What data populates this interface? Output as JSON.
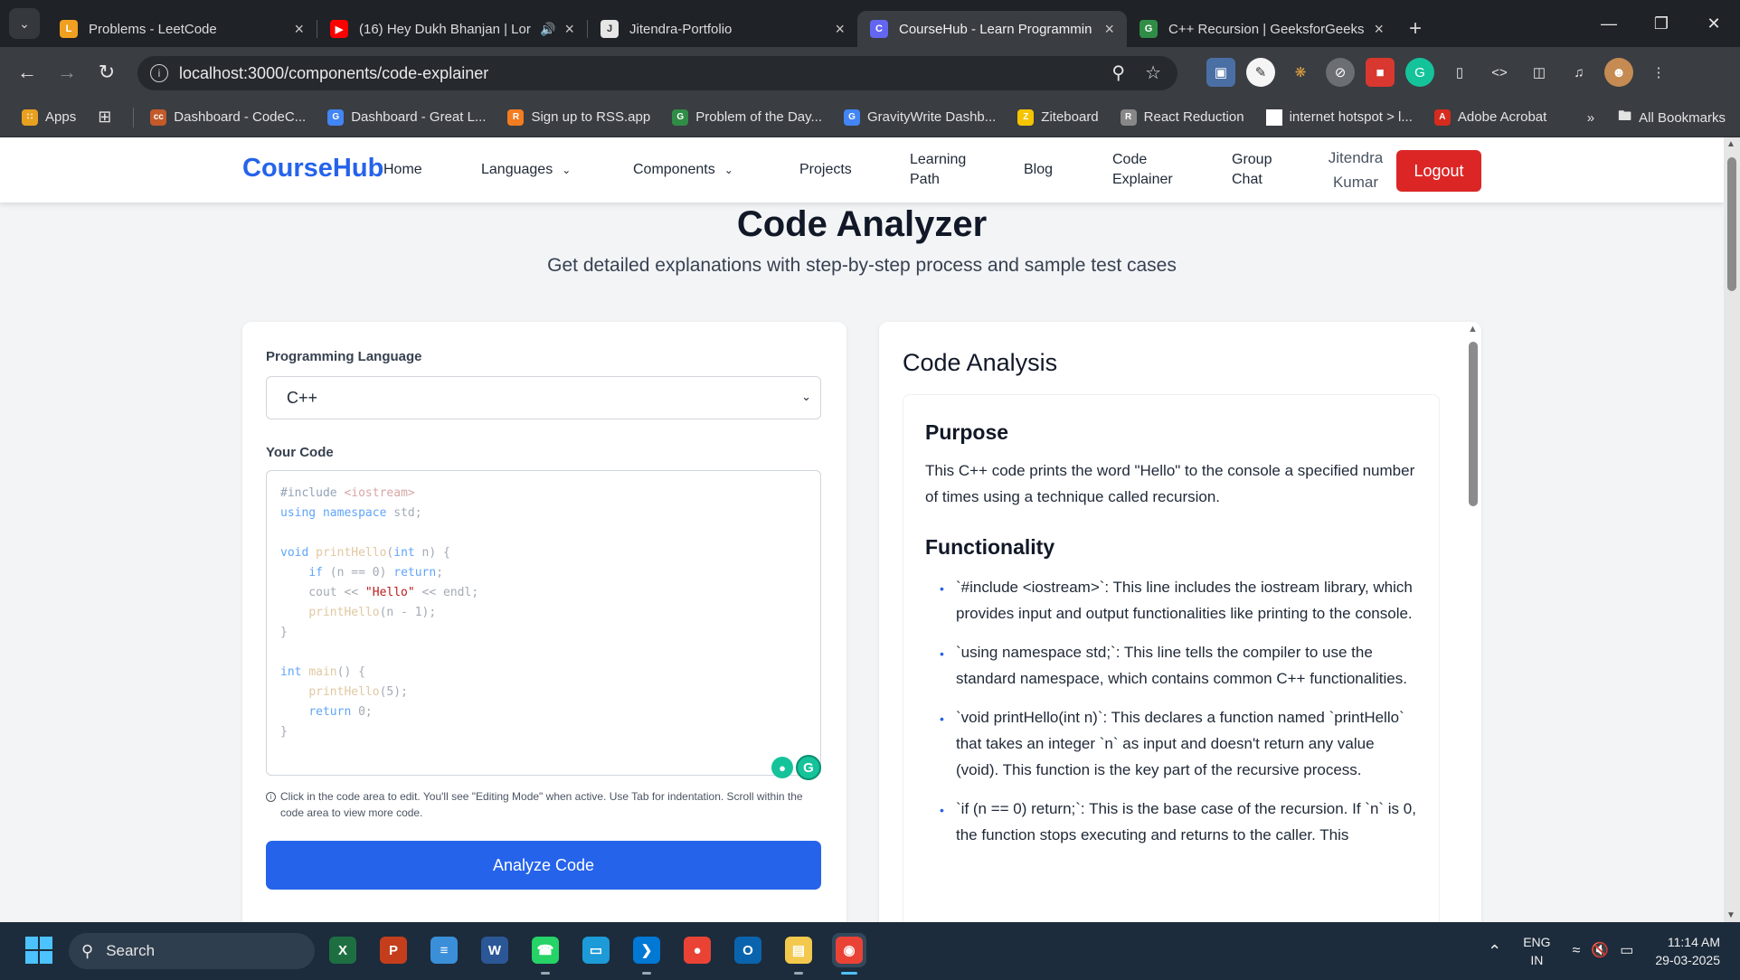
{
  "browser": {
    "tabs": [
      {
        "title": "Problems - LeetCode",
        "favicon_color": "#f0a020",
        "favicon_glyph": "L",
        "active": false,
        "playing": false
      },
      {
        "title": "(16) Hey Dukh Bhanjan | Lor",
        "favicon_color": "#ff0000",
        "favicon_glyph": "▶",
        "active": false,
        "playing": true
      },
      {
        "title": "Jitendra-Portfolio",
        "favicon_color": "#e6e6e6",
        "favicon_glyph": "J",
        "active": false,
        "playing": false
      },
      {
        "title": "CourseHub - Learn Programmin",
        "favicon_color": "#6366f1",
        "favicon_glyph": "C",
        "active": true,
        "playing": false
      },
      {
        "title": "C++ Recursion | GeeksforGeeks",
        "favicon_color": "#2f8d46",
        "favicon_glyph": "G",
        "active": false,
        "playing": false
      }
    ],
    "url": "localhost:3000/components/code-explainer",
    "bookmarks": [
      {
        "label": "Apps",
        "color": "#e8a020",
        "glyph": "∷"
      },
      {
        "label": "Dashboard - CodeC...",
        "color": "#c45a2a",
        "glyph": "cc"
      },
      {
        "label": "Dashboard - Great L...",
        "color": "#4285f4",
        "glyph": "G"
      },
      {
        "label": "Sign up to RSS.app",
        "color": "#f47c20",
        "glyph": "R"
      },
      {
        "label": "Problem of the Day...",
        "color": "#2f8d46",
        "glyph": "G"
      },
      {
        "label": "GravityWrite Dashb...",
        "color": "#4285f4",
        "glyph": "G"
      },
      {
        "label": "Ziteboard",
        "color": "#f5c400",
        "glyph": "Z"
      },
      {
        "label": "React Reduction",
        "color": "#888888",
        "glyph": "R"
      },
      {
        "label": "internet hotspot > l...",
        "color": "#ffffff",
        "glyph": ""
      },
      {
        "label": "Adobe Acrobat",
        "color": "#d62b1f",
        "glyph": "A"
      }
    ],
    "all_bookmarks_label": "All Bookmarks"
  },
  "site": {
    "brand": "CourseHub",
    "nav": [
      {
        "label": "Home",
        "dropdown": false
      },
      {
        "label": "Languages",
        "dropdown": true
      },
      {
        "label": "Components",
        "dropdown": true
      },
      {
        "label": "Projects",
        "dropdown": false
      },
      {
        "label": "Learning Path",
        "dropdown": false
      },
      {
        "label": "Blog",
        "dropdown": false
      },
      {
        "label": "Code Explainer",
        "dropdown": false
      },
      {
        "label": "Group Chat",
        "dropdown": false
      }
    ],
    "user_name": "Jitendra Kumar",
    "logout_label": "Logout",
    "accent": "#2563eb",
    "danger": "#dc2626"
  },
  "page": {
    "title": "Code Analyzer",
    "subtitle": "Get detailed explanations with step-by-step process and sample test cases"
  },
  "editor": {
    "language_label": "Programming Language",
    "language_value": "C++",
    "code_label": "Your Code",
    "hint": "Click in the code area to edit. You'll see \"Editing Mode\" when active. Use Tab for indentation. Scroll within the code area to view more code.",
    "analyze_label": "Analyze Code",
    "code": [
      "#include <iostream>",
      "using namespace std;",
      "",
      "void printHello(int n) {",
      "    if (n == 0) return;",
      "    cout << \"Hello\" << endl;",
      "    printHello(n - 1);",
      "}",
      "",
      "int main() {",
      "    printHello(5);",
      "    return 0;",
      "}"
    ]
  },
  "analysis": {
    "title": "Code Analysis",
    "purpose_heading": "Purpose",
    "purpose_text": "This C++ code prints the word \"Hello\" to the console a specified number of times using a technique called recursion.",
    "functionality_heading": "Functionality",
    "functionality_items": [
      "`#include <iostream>`: This line includes the iostream library, which provides input and output functionalities like printing to the console.",
      "`using namespace std;`: This line tells the compiler to use the standard namespace, which contains common C++ functionalities.",
      "`void printHello(int n)`: This declares a function named `printHello` that takes an integer `n` as input and doesn't return any value (void). This function is the key part of the recursive process.",
      "`if (n == 0) return;`: This is the base case of the recursion. If `n` is 0, the function stops executing and returns to the caller. This"
    ]
  },
  "taskbar": {
    "search_label": "Search",
    "lang_top": "ENG",
    "lang_bottom": "IN",
    "time": "11:14 AM",
    "date": "29-03-2025",
    "apps": [
      {
        "name": "excel",
        "color": "#1d6f42",
        "glyph": "X",
        "running": false
      },
      {
        "name": "powerpoint",
        "color": "#c43e1c",
        "glyph": "P",
        "running": false
      },
      {
        "name": "notepad",
        "color": "#3a8fd8",
        "glyph": "≡",
        "running": false
      },
      {
        "name": "word",
        "color": "#2b5797",
        "glyph": "W",
        "running": false
      },
      {
        "name": "whatsapp",
        "color": "#25d366",
        "glyph": "☎",
        "running": true
      },
      {
        "name": "desktop",
        "color": "#1d9bd8",
        "glyph": "▭",
        "running": false
      },
      {
        "name": "vscode",
        "color": "#0078d4",
        "glyph": "❯",
        "running": true
      },
      {
        "name": "chrome",
        "color": "#ea4335",
        "glyph": "●",
        "running": false
      },
      {
        "name": "outlook",
        "color": "#0a64ad",
        "glyph": "O",
        "running": false
      },
      {
        "name": "file-explorer",
        "color": "#f2c94c",
        "glyph": "▤",
        "running": true
      },
      {
        "name": "chrome-active",
        "color": "#ea4335",
        "glyph": "◉",
        "running": true
      }
    ]
  }
}
